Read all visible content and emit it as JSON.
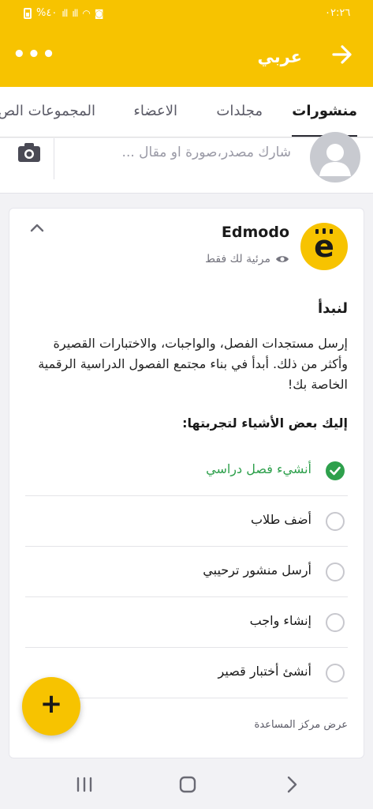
{
  "status_bar": {
    "time": "٠٢:٢٦",
    "battery": "%٤٠"
  },
  "app_bar": {
    "title": "عربي",
    "more_label": "•••"
  },
  "tabs": [
    {
      "label": "منشورات",
      "active": true
    },
    {
      "label": "مجلدات",
      "active": false
    },
    {
      "label": "الاعضاء",
      "active": false
    },
    {
      "label": "المجموعات الص",
      "active": false
    }
  ],
  "composer": {
    "placeholder": "شارك مصدر،صورة او مقال ..."
  },
  "post": {
    "sender": "Edmodo",
    "visibility": "مرئية لك فقط",
    "logo_letter": "e",
    "heading": "لنبدأ",
    "intro": "إرسل مستجدات الفصل، والواجبات، والاختبارات القصيرة وأكثر من ذلك. أبدأ في بناء مجتمع الفصول الدراسية الرقمية الخاصة بك!",
    "subheading": "إليك بعض الأشياء لتجربتها:",
    "checklist": [
      {
        "label": "أنشيء فصل دراسي",
        "done": true
      },
      {
        "label": "أضف طلاب",
        "done": false
      },
      {
        "label": "أرسل منشور ترحيبي",
        "done": false
      },
      {
        "label": "إنشاء واجب",
        "done": false
      },
      {
        "label": "أنشئ أختبار قصير",
        "done": false
      }
    ],
    "help_link": "عرض مركز المساعدة"
  },
  "fab": {
    "label": "+"
  },
  "colors": {
    "brand_yellow": "#f7c300",
    "done_green": "#2ea04c"
  }
}
